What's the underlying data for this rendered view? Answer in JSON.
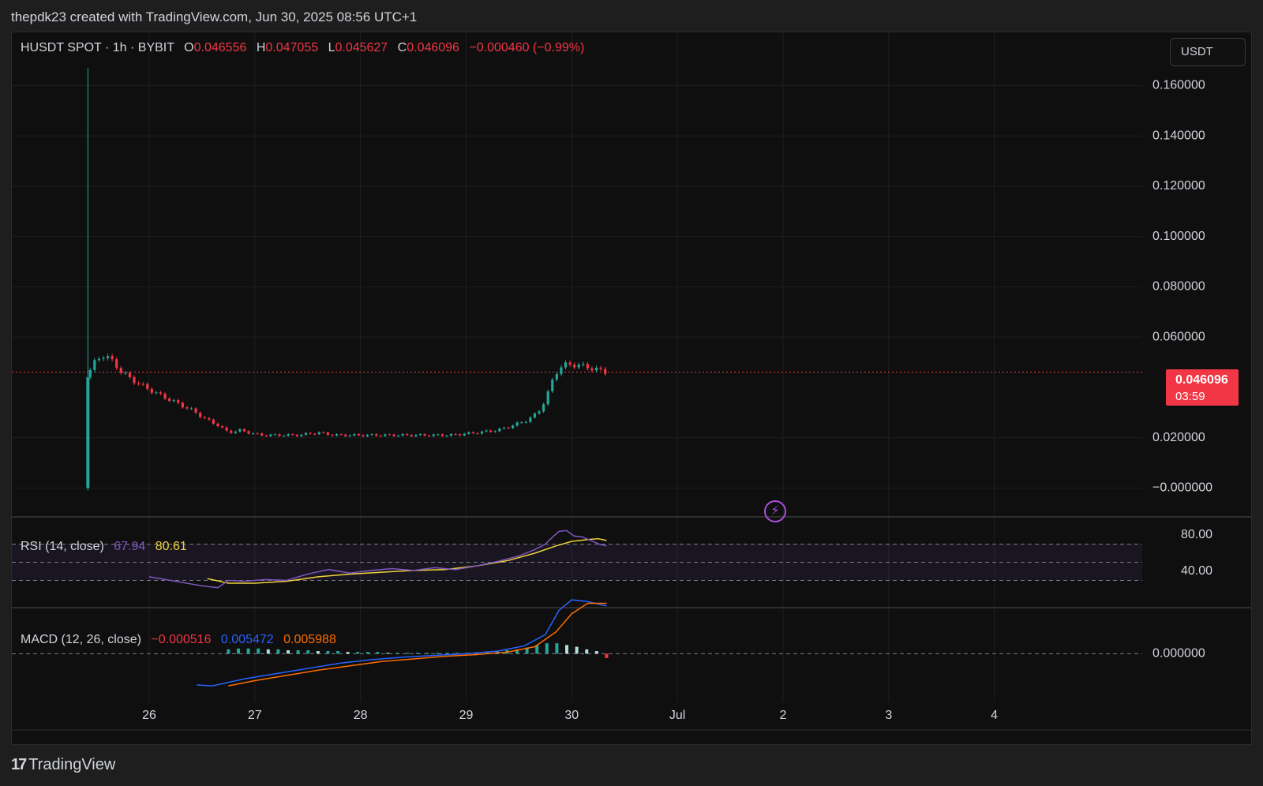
{
  "header": {
    "caption": "thepdk23 created with TradingView.com, Jun 30, 2025 08:56 UTC+1"
  },
  "legend": {
    "symbol": "HUSDT SPOT · 1h · BYBIT",
    "o_label": "O",
    "o_value": "0.046556",
    "h_label": "H",
    "h_value": "0.047055",
    "l_label": "L",
    "l_value": "0.045627",
    "c_label": "C",
    "c_value": "0.046096",
    "change": "−0.000460 (−0.99%)"
  },
  "currency_button": "USDT",
  "last_price_tag": {
    "price": "0.046096",
    "countdown": "03:59"
  },
  "rsi_legend": {
    "label": "RSI (14, close)",
    "rsi": "67.94",
    "ma": "80.61"
  },
  "macd_legend": {
    "label": "MACD (12, 26, close)",
    "hist": "−0.000516",
    "macd": "0.005472",
    "signal": "0.005988"
  },
  "footer": {
    "brand": "TradingView"
  },
  "colors": {
    "up": "#26a69a",
    "down": "#f23645",
    "rsi_line": "#7e57c2",
    "rsi_ma": "#f0d23c",
    "macd_line": "#2962ff",
    "signal_line": "#ff6d00",
    "hist_pos_dark": "#26a69a",
    "hist_pos_light": "#b2dfdb",
    "last_price": "#f23645"
  },
  "chart_data": [
    {
      "type": "candlestick",
      "title": "HUSDT SPOT · 1h · BYBIT",
      "y_ticks": [
        "0.160000",
        "0.140000",
        "0.120000",
        "0.100000",
        "0.080000",
        "0.060000",
        "0.020000",
        "−0.000000"
      ],
      "y_tick_values": [
        0.16,
        0.14,
        0.12,
        0.1,
        0.08,
        0.06,
        0.02,
        0.0
      ],
      "ylim": [
        -0.0115,
        0.1815
      ],
      "x_ticks": [
        "26",
        "27",
        "28",
        "29",
        "30",
        "Jul",
        "2",
        "3",
        "4"
      ],
      "x_tick_days": [
        26,
        27,
        28,
        29,
        30,
        31,
        32,
        33,
        34
      ],
      "xlim": [
        24.7,
        35.4
      ],
      "last_price": 0.046096,
      "grid": true,
      "price_path": [
        [
          25.4,
          0.044
        ],
        [
          25.5,
          0.051
        ],
        [
          25.58,
          0.053
        ],
        [
          25.66,
          0.05
        ],
        [
          25.74,
          0.046
        ],
        [
          25.84,
          0.043
        ],
        [
          25.96,
          0.04
        ],
        [
          26.1,
          0.037
        ],
        [
          26.25,
          0.034
        ],
        [
          26.4,
          0.031
        ],
        [
          26.55,
          0.027
        ],
        [
          26.65,
          0.025
        ],
        [
          26.75,
          0.022
        ],
        [
          26.85,
          0.023
        ],
        [
          26.95,
          0.022
        ],
        [
          27.05,
          0.021
        ],
        [
          27.2,
          0.021
        ],
        [
          27.4,
          0.021
        ],
        [
          27.6,
          0.022
        ],
        [
          27.75,
          0.021
        ],
        [
          28.0,
          0.021
        ],
        [
          28.3,
          0.021
        ],
        [
          28.6,
          0.021
        ],
        [
          28.85,
          0.021
        ],
        [
          29.1,
          0.022
        ],
        [
          29.3,
          0.023
        ],
        [
          29.45,
          0.025
        ],
        [
          29.58,
          0.027
        ],
        [
          29.68,
          0.03
        ],
        [
          29.75,
          0.035
        ],
        [
          29.82,
          0.043
        ],
        [
          29.88,
          0.048
        ],
        [
          29.95,
          0.049
        ],
        [
          30.05,
          0.049
        ],
        [
          30.15,
          0.048
        ],
        [
          30.25,
          0.047
        ],
        [
          30.33,
          0.046
        ]
      ],
      "spike_candle": {
        "day": 25.42,
        "open": 0.0,
        "close": 0.044,
        "high": 0.167,
        "low": -0.001
      }
    },
    {
      "type": "line",
      "title": "RSI (14, close)",
      "y_ticks": [
        "80.00",
        "40.00"
      ],
      "y_tick_values": [
        80,
        40
      ],
      "ylim": [
        0,
        100
      ],
      "bands": [
        70,
        50,
        30
      ],
      "series": [
        {
          "name": "RSI",
          "points": [
            [
              26.0,
              34
            ],
            [
              26.3,
              28
            ],
            [
              26.5,
              24
            ],
            [
              26.65,
              22
            ],
            [
              26.75,
              30
            ],
            [
              26.9,
              29
            ],
            [
              27.1,
              31
            ],
            [
              27.3,
              30
            ],
            [
              27.5,
              37
            ],
            [
              27.7,
              42
            ],
            [
              27.9,
              38
            ],
            [
              28.1,
              41
            ],
            [
              28.3,
              43
            ],
            [
              28.5,
              41
            ],
            [
              28.7,
              44
            ],
            [
              28.9,
              42
            ],
            [
              29.1,
              46
            ],
            [
              29.3,
              51
            ],
            [
              29.5,
              57
            ],
            [
              29.65,
              64
            ],
            [
              29.75,
              70
            ],
            [
              29.82,
              78
            ],
            [
              29.88,
              84
            ],
            [
              29.95,
              85
            ],
            [
              30.02,
              79
            ],
            [
              30.1,
              78
            ],
            [
              30.18,
              74
            ],
            [
              30.26,
              70
            ],
            [
              30.33,
              68
            ]
          ]
        },
        {
          "name": "RSI-based MA",
          "points": [
            [
              26.55,
              32
            ],
            [
              26.75,
              27
            ],
            [
              27.0,
              27
            ],
            [
              27.3,
              29
            ],
            [
              27.6,
              34
            ],
            [
              27.9,
              37
            ],
            [
              28.2,
              39
            ],
            [
              28.5,
              41
            ],
            [
              28.8,
              42
            ],
            [
              29.1,
              46
            ],
            [
              29.4,
              52
            ],
            [
              29.65,
              60
            ],
            [
              29.85,
              68
            ],
            [
              30.0,
              73
            ],
            [
              30.15,
              75
            ],
            [
              30.25,
              76
            ],
            [
              30.33,
              74
            ]
          ]
        }
      ]
    },
    {
      "type": "line",
      "title": "MACD (12, 26, close)",
      "y_ticks": [
        "0.000000"
      ],
      "y_tick_values": [
        0
      ],
      "ylim": [
        -0.0056,
        0.0053
      ],
      "series": [
        {
          "name": "MACD",
          "points": [
            [
              26.45,
              -0.0036
            ],
            [
              26.6,
              -0.0037
            ],
            [
              26.9,
              -0.0029
            ],
            [
              27.2,
              -0.0023
            ],
            [
              27.5,
              -0.0017
            ],
            [
              27.8,
              -0.0011
            ],
            [
              28.1,
              -0.0007
            ],
            [
              28.4,
              -0.0004
            ],
            [
              28.7,
              -0.0002
            ],
            [
              29.0,
              0.0
            ],
            [
              29.3,
              0.0003
            ],
            [
              29.55,
              0.0009
            ],
            [
              29.75,
              0.0022
            ],
            [
              29.88,
              0.005
            ],
            [
              30.0,
              0.0062
            ],
            [
              30.15,
              0.006
            ],
            [
              30.33,
              0.0055
            ]
          ]
        },
        {
          "name": "Signal",
          "points": [
            [
              26.75,
              -0.0037
            ],
            [
              27.0,
              -0.0031
            ],
            [
              27.3,
              -0.0025
            ],
            [
              27.6,
              -0.0019
            ],
            [
              27.9,
              -0.0014
            ],
            [
              28.2,
              -0.0009
            ],
            [
              28.5,
              -0.0006
            ],
            [
              28.8,
              -0.0003
            ],
            [
              29.1,
              -0.0001
            ],
            [
              29.4,
              0.0002
            ],
            [
              29.65,
              0.0008
            ],
            [
              29.85,
              0.0025
            ],
            [
              30.0,
              0.0046
            ],
            [
              30.15,
              0.0058
            ],
            [
              30.33,
              0.0058
            ]
          ]
        }
      ],
      "histogram": [
        0.0005,
        0.0006,
        0.0006,
        0.0006,
        0.0005,
        0.0005,
        0.0004,
        0.0004,
        0.0004,
        0.0003,
        0.0003,
        0.0003,
        0.0002,
        0.0002,
        0.0002,
        0.0002,
        0.0001,
        0.0001,
        0.0001,
        0.0001,
        0.0001,
        0.0001,
        0.0001,
        0.0001,
        0.0001,
        0.0001,
        0.0002,
        0.0003,
        0.0004,
        0.0005,
        0.0007,
        0.001,
        0.0012,
        0.0012,
        0.001,
        0.0008,
        0.0005,
        0.0003,
        -0.0005
      ],
      "histogram_start_day": 26.75,
      "histogram_end_day": 30.33
    }
  ]
}
